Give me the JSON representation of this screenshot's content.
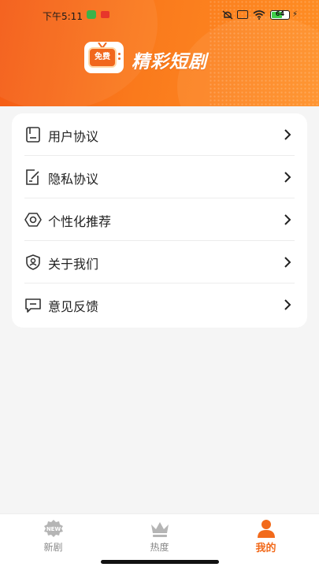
{
  "status_bar": {
    "time": "下午5:11",
    "battery": "64",
    "battery_level": 0.64
  },
  "header": {
    "logo_text": "免费",
    "app_title": "精彩短剧",
    "accent_color": "#f45a14"
  },
  "menu": {
    "items": [
      {
        "label": "用户协议",
        "icon": "document-icon"
      },
      {
        "label": "隐私协议",
        "icon": "edit-document-icon"
      },
      {
        "label": "个性化推荐",
        "icon": "settings-icon"
      },
      {
        "label": "关于我们",
        "icon": "shield-person-icon"
      },
      {
        "label": "意见反馈",
        "icon": "feedback-icon"
      }
    ]
  },
  "bottom_nav": {
    "items": [
      {
        "label": "新剧",
        "icon": "new-badge-icon",
        "active": false
      },
      {
        "label": "热度",
        "icon": "crown-icon",
        "active": false
      },
      {
        "label": "我的",
        "icon": "person-icon",
        "active": true
      }
    ],
    "active_color": "#f26a1b"
  }
}
